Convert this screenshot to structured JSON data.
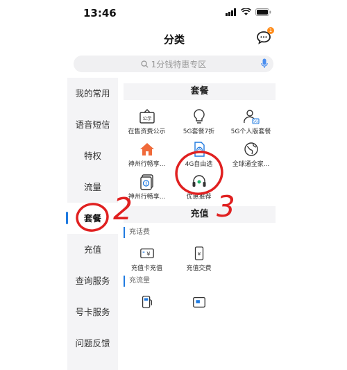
{
  "status": {
    "time": "13:46"
  },
  "nav": {
    "title": "分类",
    "badge": "1"
  },
  "search": {
    "placeholder": "1分钱特惠专区"
  },
  "sidebar": {
    "items": [
      {
        "label": "我的常用"
      },
      {
        "label": "语音短信"
      },
      {
        "label": "特权"
      },
      {
        "label": "流量"
      },
      {
        "label": "套餐",
        "active": true
      },
      {
        "label": "充值"
      },
      {
        "label": "查询服务"
      },
      {
        "label": "号卡服务"
      },
      {
        "label": "问题反馈"
      }
    ]
  },
  "package": {
    "title": "套餐",
    "items": [
      {
        "label": "在售资费公示",
        "icon": "notice-board-icon",
        "icon_text": "公示"
      },
      {
        "label": "5G套餐7折",
        "icon": "lightbulb-icon"
      },
      {
        "label": "5G个人版套餐",
        "icon": "user-5g-icon",
        "icon_text": "5G"
      },
      {
        "label": "神州行畅享...",
        "icon": "home-icon"
      },
      {
        "label": "4G自由选",
        "icon": "sim-card-icon"
      },
      {
        "label": "全球通全家...",
        "icon": "globe-icon"
      },
      {
        "label": "神州行畅享...",
        "icon": "dollar-card-icon"
      },
      {
        "label": "优惠推荐",
        "icon": "headset-icon"
      }
    ]
  },
  "recharge": {
    "title": "充值",
    "phone_fee": {
      "title": "充话费",
      "items": [
        {
          "label": "充值卡充值",
          "icon": "yen-card-icon"
        },
        {
          "label": "充值交费",
          "icon": "yen-phone-icon"
        }
      ]
    },
    "data_fee": {
      "title": "充流量",
      "items": [
        {
          "label": "",
          "icon": "fuel-icon"
        },
        {
          "label": "",
          "icon": "card-icon"
        }
      ]
    }
  },
  "annotations": [
    "2",
    "3"
  ],
  "colors": {
    "accent": "#1f7ae0",
    "annotation": "#e02020",
    "home": "#f06a3a"
  }
}
